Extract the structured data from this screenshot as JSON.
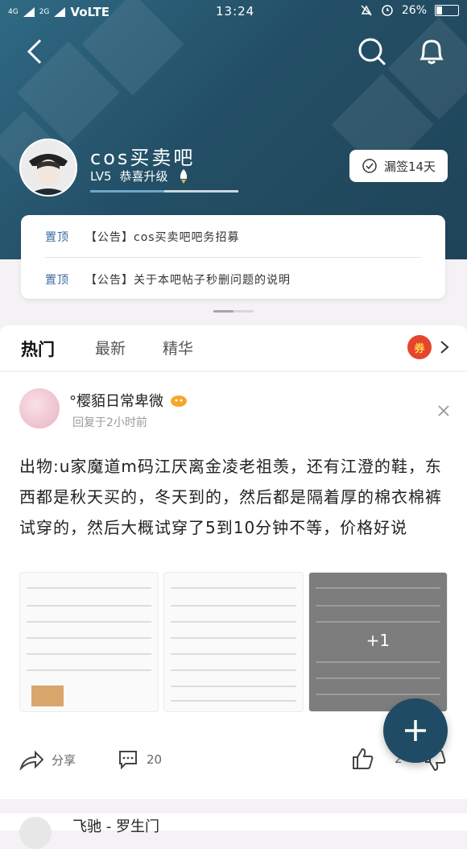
{
  "status_bar": {
    "signal_left": "4G",
    "signal_mid": "2G",
    "carrier": "VoLTE",
    "time": "13:24",
    "battery_percent": "26%",
    "battery_level": 0.26
  },
  "forum": {
    "title": "cos买卖吧",
    "level": "LV5",
    "level_name": "恭喜升级",
    "level_progress": 0.5,
    "checkin_label": "漏签14天"
  },
  "pinned": [
    {
      "tag": "置顶",
      "text": "【公告】cos买卖吧吧务招募"
    },
    {
      "tag": "置顶",
      "text": "【公告】关于本吧帖子秒删问题的说明"
    }
  ],
  "tabs": [
    {
      "label": "热门"
    },
    {
      "label": "最新"
    },
    {
      "label": "精华"
    }
  ],
  "coupon_label": "券",
  "post": {
    "author": "°樱貊日常卑微",
    "meta": "回复于2小时前",
    "body": "出物:u家魔道m码江厌离金凌老祖羡，还有江澄的鞋，东西都是秋天买的，冬天到的，然后都是隔着厚的棉衣棉裤试穿的，然后大概试穿了5到10分钟不等，价格好说",
    "more_images": "+1",
    "share_label": "分享",
    "comment_count": "20",
    "like_count": "2"
  },
  "next_post": {
    "author": "飞驰 - 罗生门"
  }
}
